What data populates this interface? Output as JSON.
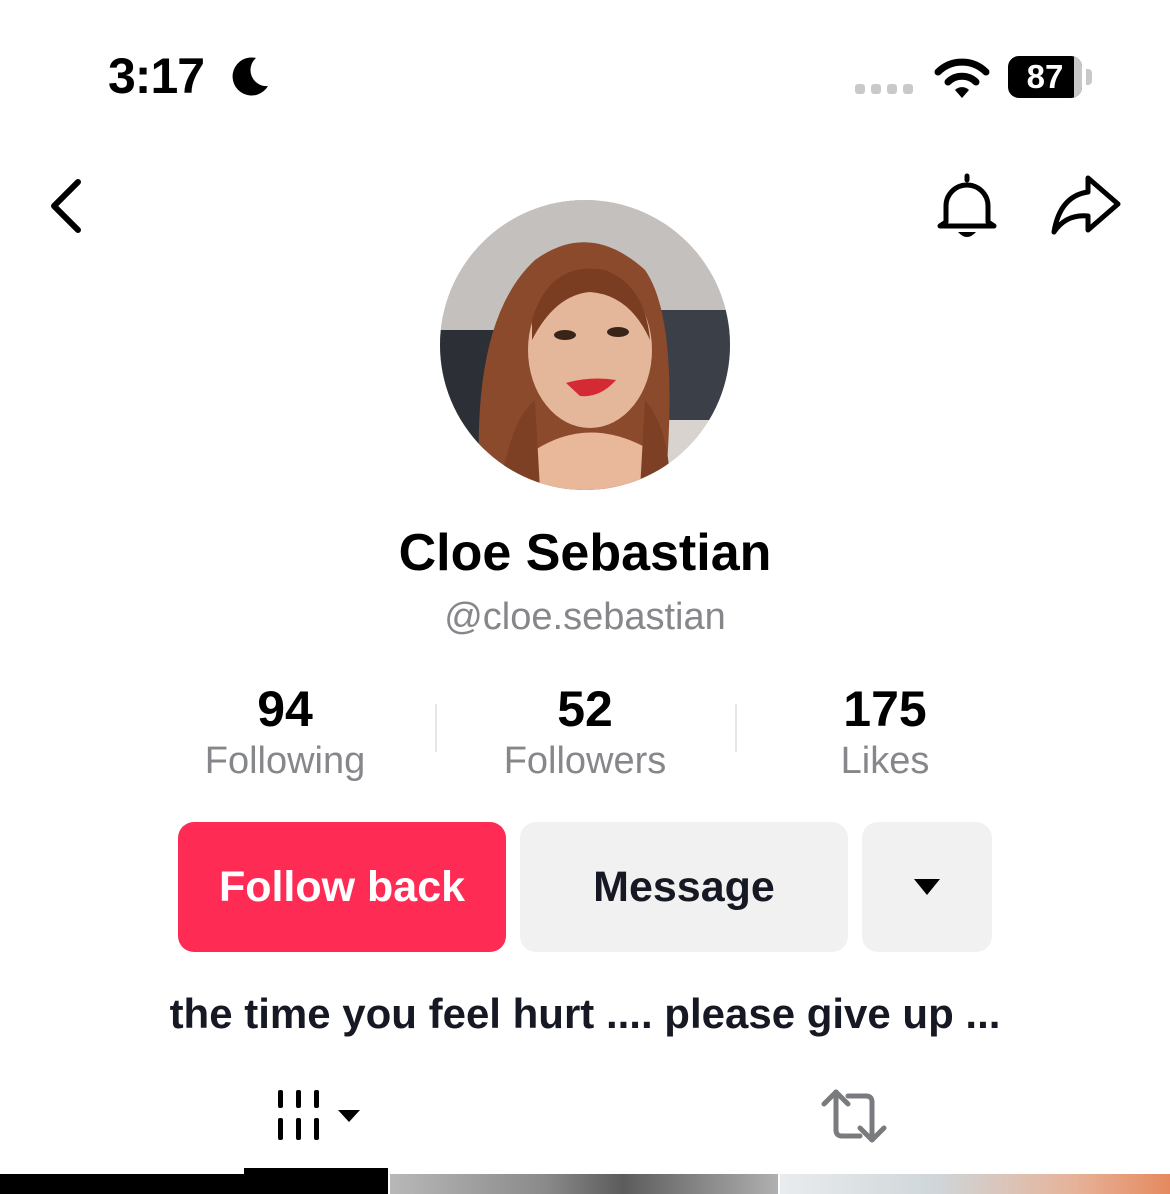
{
  "status_bar": {
    "time": "3:17",
    "battery_level": "87",
    "icons": [
      "moon-icon",
      "cellular-signal-icon",
      "wifi-icon",
      "battery-icon"
    ]
  },
  "header": {
    "icons": [
      "chevron-left-icon",
      "bell-icon",
      "share-arrow-icon"
    ]
  },
  "profile": {
    "display_name": "Cloe Sebastian",
    "username": "@cloe.sebastian",
    "bio": "the time you feel hurt .... please give up ..."
  },
  "stats": [
    {
      "value": "94",
      "label": "Following"
    },
    {
      "value": "52",
      "label": "Followers"
    },
    {
      "value": "175",
      "label": "Likes"
    }
  ],
  "actions": {
    "follow_back_label": "Follow back",
    "message_label": "Message"
  },
  "tabs": {
    "icons": [
      "videos-grid-icon",
      "repost-icon"
    ],
    "active_index": 0
  },
  "colors": {
    "accent": "#fe2c55",
    "secondary_button": "#f1f1f2",
    "muted_text": "#86878b"
  }
}
